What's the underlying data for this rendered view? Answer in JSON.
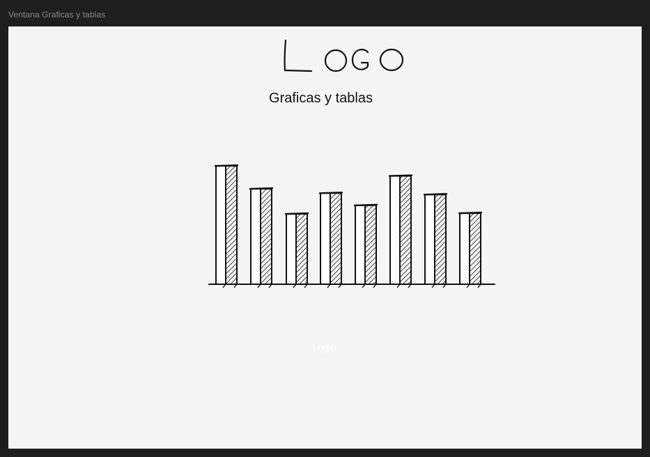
{
  "window": {
    "title": "Ventana Graficas y tablas"
  },
  "header": {
    "logo_text": "LOGO",
    "title": "Graficas y tablas"
  },
  "chart_data": {
    "type": "bar",
    "style": "hand-drawn sketch with hatched bars",
    "categories": [
      "",
      "",
      "",
      "",
      "",
      "",
      "",
      ""
    ],
    "values": [
      165,
      133,
      98,
      127,
      110,
      151,
      125,
      99
    ],
    "ylim": [
      0,
      170
    ],
    "grid": false,
    "legend": "none"
  },
  "actions": {
    "login_label": "Login"
  },
  "colors": {
    "background": "#1e1e1e",
    "canvas": "#f5f5f5",
    "ink": "#111111",
    "login_text": "#ffffff"
  }
}
